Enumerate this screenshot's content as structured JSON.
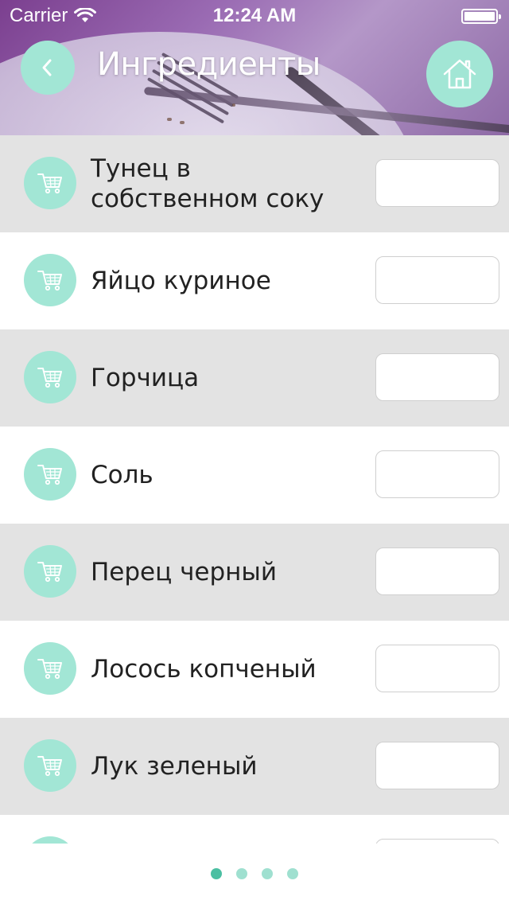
{
  "status_bar": {
    "carrier": "Carrier",
    "time": "12:24 AM"
  },
  "header": {
    "title": "Ингредиенты",
    "back_icon": "chevron-left-icon",
    "home_icon": "home-icon"
  },
  "ingredients": [
    {
      "name": "Тунец в собственном соку",
      "quantity": ""
    },
    {
      "name": "Яйцо куриное",
      "quantity": ""
    },
    {
      "name": "Горчица",
      "quantity": ""
    },
    {
      "name": "Соль",
      "quantity": ""
    },
    {
      "name": "Перец черный",
      "quantity": ""
    },
    {
      "name": "Лосось копченый",
      "quantity": ""
    },
    {
      "name": "Лук зеленый",
      "quantity": ""
    }
  ],
  "pager": {
    "count": 4,
    "active_index": 0
  },
  "colors": {
    "accent": "#a2e6d5",
    "accent_dark": "#4bbfa2",
    "row_gray": "#e3e3e3",
    "header_purple": "#8e5fa6"
  }
}
